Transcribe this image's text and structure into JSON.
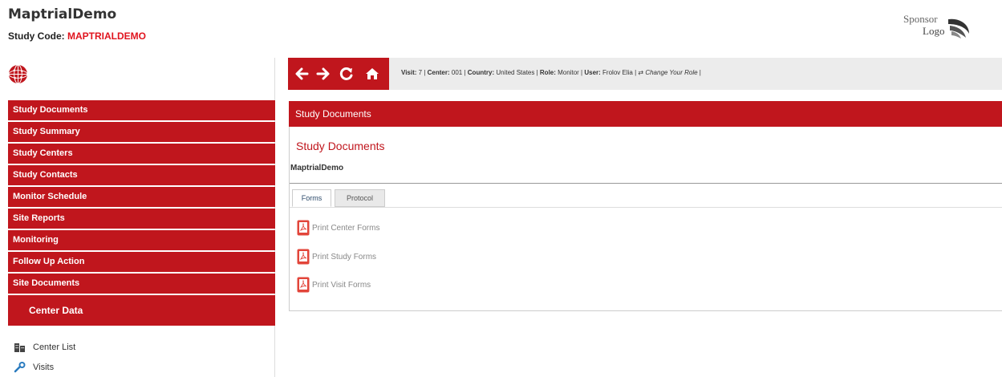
{
  "header": {
    "app_title": "MaptrialDemo",
    "study_code_label": "Study Code:",
    "study_code_value": "MAPTRIALDEMO"
  },
  "sponsor_logo": {
    "line1": "Sponsor",
    "line2": "Logo"
  },
  "toolbar": {
    "nav_icons": [
      "arrow-left-icon",
      "arrow-right-icon",
      "refresh-icon",
      "home-icon"
    ],
    "visit_label": "Visit:",
    "visit_value": "7",
    "center_label": "Center:",
    "center_value": "001",
    "country_label": "Country:",
    "country_value": "United States",
    "role_label": "Role:",
    "role_value": "Monitor",
    "user_label": "User:",
    "user_value": "Frolov Elia",
    "change_role": "Change Your Role"
  },
  "sidebar": {
    "items": [
      {
        "label": "Study Documents"
      },
      {
        "label": "Study Summary"
      },
      {
        "label": "Study Centers"
      },
      {
        "label": "Study Contacts"
      },
      {
        "label": "Monitor Schedule"
      },
      {
        "label": "Site Reports"
      },
      {
        "label": "Monitoring"
      },
      {
        "label": "Follow Up Action"
      },
      {
        "label": "Site Documents"
      }
    ],
    "section_title": "Center Data",
    "links": [
      {
        "label": "Center List",
        "icon": "building-icon"
      },
      {
        "label": "Visits",
        "icon": "wrench-icon"
      }
    ]
  },
  "main": {
    "header_title": "Study Documents",
    "panel_title": "Study Documents",
    "panel_subtitle": "MaptrialDemo",
    "tabs": [
      {
        "label": "Forms",
        "active": true
      },
      {
        "label": "Protocol",
        "active": false
      }
    ],
    "documents": [
      {
        "label": "Print Center Forms",
        "icon": "pdf-icon"
      },
      {
        "label": "Print Study Forms",
        "icon": "pdf-icon"
      },
      {
        "label": "Print Visit Forms",
        "icon": "pdf-icon"
      }
    ]
  },
  "colors": {
    "accent": "#c0161d",
    "code_red": "#e0141e",
    "toolbar_bg": "#ececec"
  }
}
